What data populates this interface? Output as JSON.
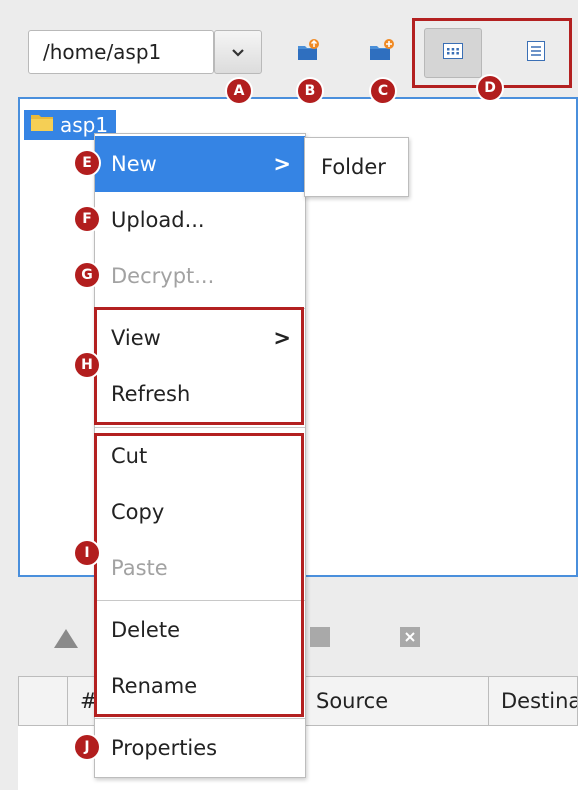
{
  "toolbar": {
    "path_value": "/home/asp1",
    "dropdown_icon": "chevron-down-icon",
    "upload_icon": "folder-upload-icon",
    "new_folder_icon": "new-folder-icon",
    "icon_view_icon": "grid-view-icon",
    "list_view_icon": "list-view-icon"
  },
  "badges": {
    "a": "A",
    "b": "B",
    "c": "C",
    "d": "D",
    "e": "E",
    "f": "F",
    "g": "G",
    "h": "H",
    "i": "I",
    "j": "J"
  },
  "tree": {
    "root_label": "asp1",
    "root_icon": "folder-icon"
  },
  "context_menu": {
    "new": "New",
    "upload": "Upload...",
    "decrypt": "Decrypt...",
    "view": "View",
    "refresh": "Refresh",
    "cut": "Cut",
    "copy": "Copy",
    "paste": "Paste",
    "delete": "Delete",
    "rename": "Rename",
    "properties": "Properties",
    "submenu_arrow": ">"
  },
  "submenu": {
    "folder": "Folder"
  },
  "transfer_table": {
    "columns": [
      "#",
      "Source",
      "Destina"
    ]
  },
  "colors": {
    "accent": "#3584e4",
    "annotation": "#b32020",
    "disabled_text": "#a2a2a2"
  }
}
